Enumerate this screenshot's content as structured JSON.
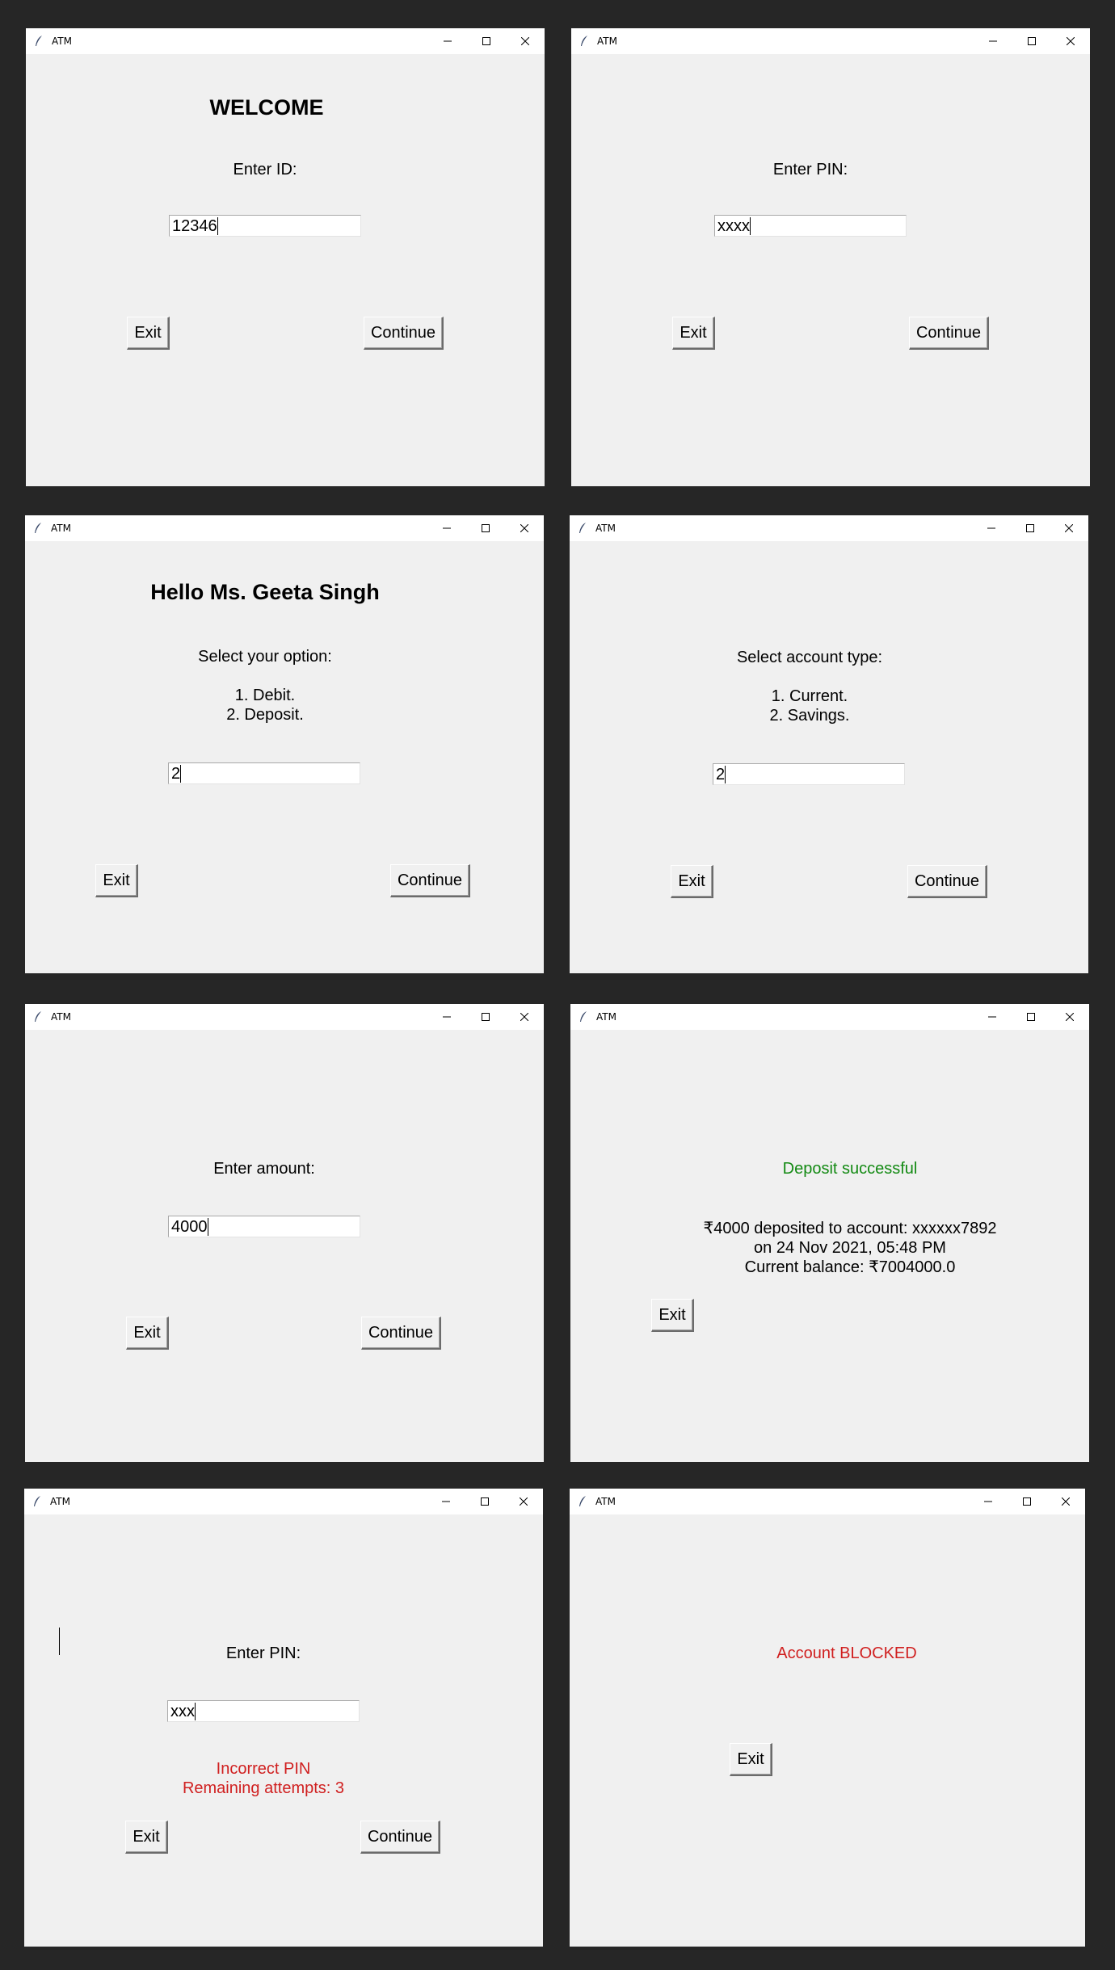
{
  "window_title": "ATM",
  "common": {
    "exit_label": "Exit",
    "continue_label": "Continue"
  },
  "welcome": {
    "heading": "WELCOME",
    "prompt": "Enter ID:",
    "input_value": "12346"
  },
  "pin_entry": {
    "prompt": "Enter PIN:",
    "input_value": "xxxx"
  },
  "menu": {
    "heading": "Hello Ms. Geeta Singh",
    "prompt": "Select your option:",
    "options": [
      "1. Debit.",
      "2. Deposit."
    ],
    "input_value": "2"
  },
  "account_type": {
    "prompt": "Select account type:",
    "options": [
      "1. Current.",
      "2. Savings."
    ],
    "input_value": "2"
  },
  "amount": {
    "prompt": "Enter amount:",
    "input_value": "4000"
  },
  "deposit_result": {
    "status": "Deposit successful",
    "details": [
      "₹4000 deposited to account: xxxxxx7892",
      "on 24 Nov 2021, 05:48 PM",
      "Current balance: ₹7004000.0"
    ]
  },
  "pin_retry": {
    "prompt": "Enter PIN:",
    "input_value": "xxx",
    "error_lines": [
      "Incorrect PIN",
      "Remaining attempts: 3"
    ]
  },
  "blocked": {
    "status": "Account BLOCKED"
  },
  "colors": {
    "success": "#138a13",
    "error": "#d01f1f",
    "window_bg": "#f0f0f0",
    "desktop_bg": "#262626"
  }
}
